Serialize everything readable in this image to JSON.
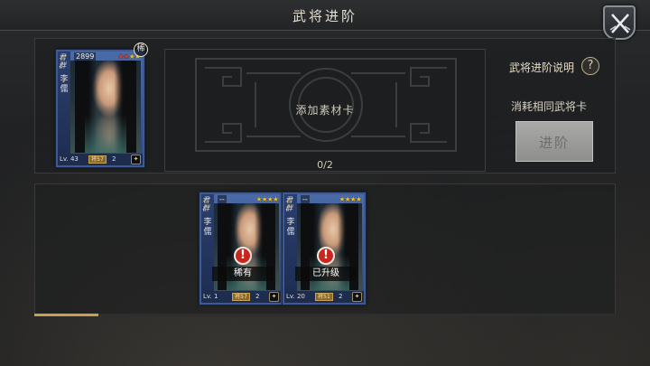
{
  "header": {
    "title": "武将进阶"
  },
  "main_hero": {
    "faction": "君群",
    "name": "李儒",
    "power": "2899",
    "stars_red": "★★",
    "stars_gold": "★★",
    "seal": "稀",
    "level": "Lv. 43",
    "troop": "将57",
    "count": "2",
    "arms": "✦"
  },
  "material_slot": {
    "label": "添加素材卡",
    "count": "0/2"
  },
  "sidebar": {
    "help_label": "武将进阶说明",
    "help_icon": "?",
    "consume_label": "消耗相同武将卡",
    "advance_label": "进阶"
  },
  "candidates": [
    {
      "faction": "君群",
      "name": "李儒",
      "power": "--",
      "stars": "★★★★",
      "level": "Lv. 1",
      "troop": "将57",
      "count": "2",
      "arms": "✦",
      "tag": "稀有",
      "warn": "!"
    },
    {
      "faction": "君群",
      "name": "李儒",
      "power": "--",
      "stars": "★★★★",
      "level": "Lv. 20",
      "troop": "将51",
      "count": "2",
      "arms": "✦",
      "tag": "已升级",
      "warn": "!"
    }
  ],
  "scroll_progress": 0.11,
  "colors": {
    "accent": "#c9a050",
    "card_border": "#3d5a96",
    "warn": "#c8261e"
  }
}
